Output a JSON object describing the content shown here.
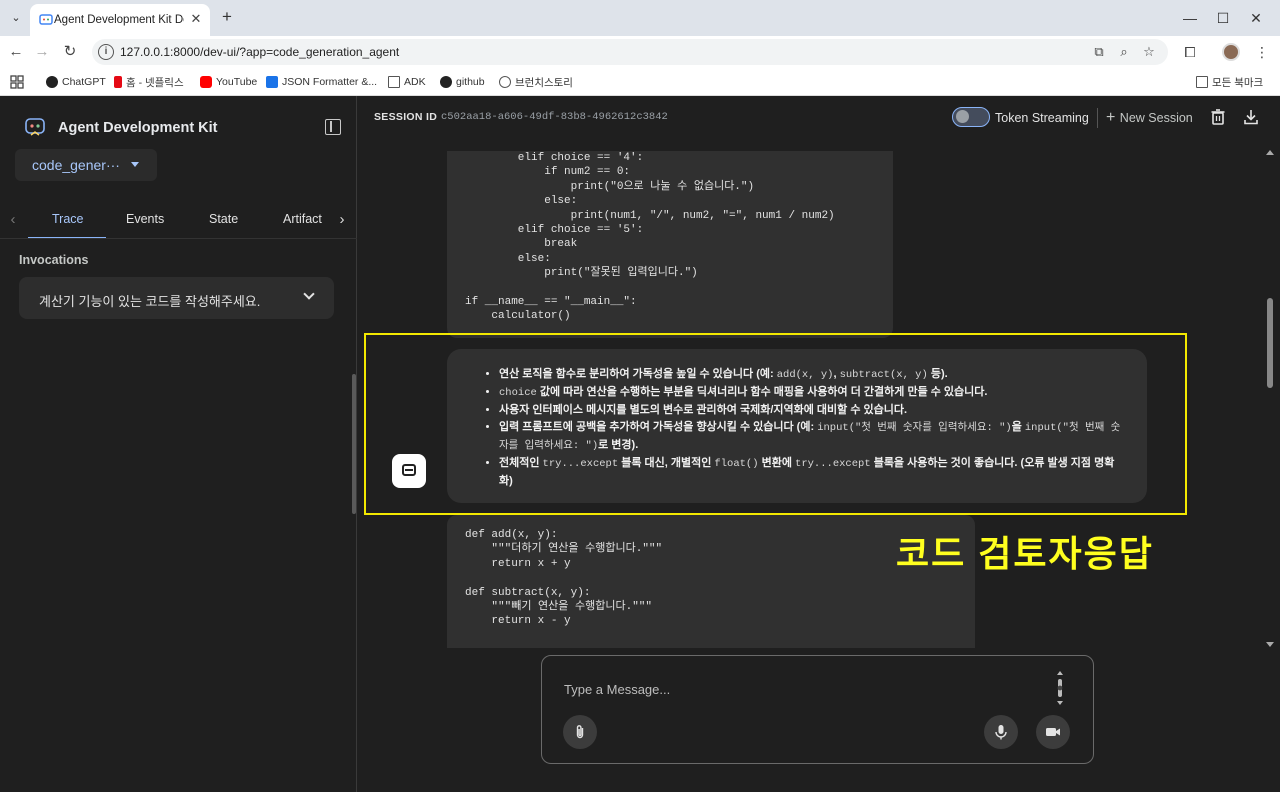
{
  "browser": {
    "tab_title": "Agent Development Kit Dev UI",
    "url": "127.0.0.1:8000/dev-ui/?app=code_generation_agent",
    "bookmarks": [
      "ChatGPT",
      "홈 - 넷플릭스",
      "YouTube",
      "JSON Formatter &...",
      "ADK",
      "github",
      "브런치스토리"
    ],
    "all_bookmarks": "모든 북마크"
  },
  "sidebar": {
    "brand": "Agent Development Kit",
    "app_name": "code_generation_agent",
    "app_name_display": "code_gener···",
    "tabs": [
      "Trace",
      "Events",
      "State",
      "Artifact"
    ],
    "active_tab": "Trace",
    "invocations_title": "Invocations",
    "invocation": "계산기 기능이 있는 코드를 작성해주세요."
  },
  "topbar": {
    "session_label": "SESSION ID",
    "session_id": "c502aa18-a606-49df-83b8-4962612c3842",
    "token_streaming": "Token Streaming",
    "new_session": "New Session"
  },
  "code_block_1": "        elif choice == '4':\n            if num2 == 0:\n                print(\"0으로 나눌 수 없습니다.\")\n            else:\n                print(num1, \"/\", num2, \"=\", num1 / num2)\n        elif choice == '5':\n            break\n        else:\n            print(\"잘못된 입력입니다.\")\n\nif __name__ == \"__main__\":\n    calculator()",
  "response": {
    "b1_pre": "연산 로직을 함수로 분리하여 가독성을 높일 수 있습니다 (예: ",
    "b1_code1": "add(x, y)",
    "b1_sep": ", ",
    "b1_code2": "subtract(x, y)",
    "b1_post": " 등).",
    "b2_code": "choice",
    "b2_post": " 값에 따라 연산을 수행하는 부분을 딕셔너리나 함수 매핑을 사용하여 더 간결하게 만들 수 있습니다.",
    "b3": "사용자 인터페이스 메시지를 별도의 변수로 관리하여 국제화/지역화에 대비할 수 있습니다.",
    "b4_pre": "입력 프롬프트에 공백을 추가하여 가독성을 향상시킬 수 있습니다 (예: ",
    "b4_code1": "input(\"첫 번째 숫자를 입력하세요: \")",
    "b4_mid": "을 ",
    "b4_code2": "input(\"첫 번째 숫자를 입력하세요: \")",
    "b4_post": "로 변경).",
    "b5_pre": "전체적인 ",
    "b5_code1": "try...except",
    "b5_mid1": " 블록 대신, 개별적인 ",
    "b5_code2": "float()",
    "b5_mid2": " 변환에 ",
    "b5_code3": "try...except",
    "b5_post": " 블록을 사용하는 것이 좋습니다. (오류 발생 지점 명확화)"
  },
  "code_block_2": "def add(x, y):\n    \"\"\"더하기 연산을 수행합니다.\"\"\"\n    return x + y\n\ndef subtract(x, y):\n    \"\"\"빼기 연산을 수행합니다.\"\"\"\n    return x - y",
  "overlay_label": "코드 검토자응답",
  "composer": {
    "placeholder": "Type a Message..."
  },
  "colors": {
    "accent": "#8ab4f8",
    "highlight": "#f2e800",
    "overlay_text": "#ffff1f"
  }
}
